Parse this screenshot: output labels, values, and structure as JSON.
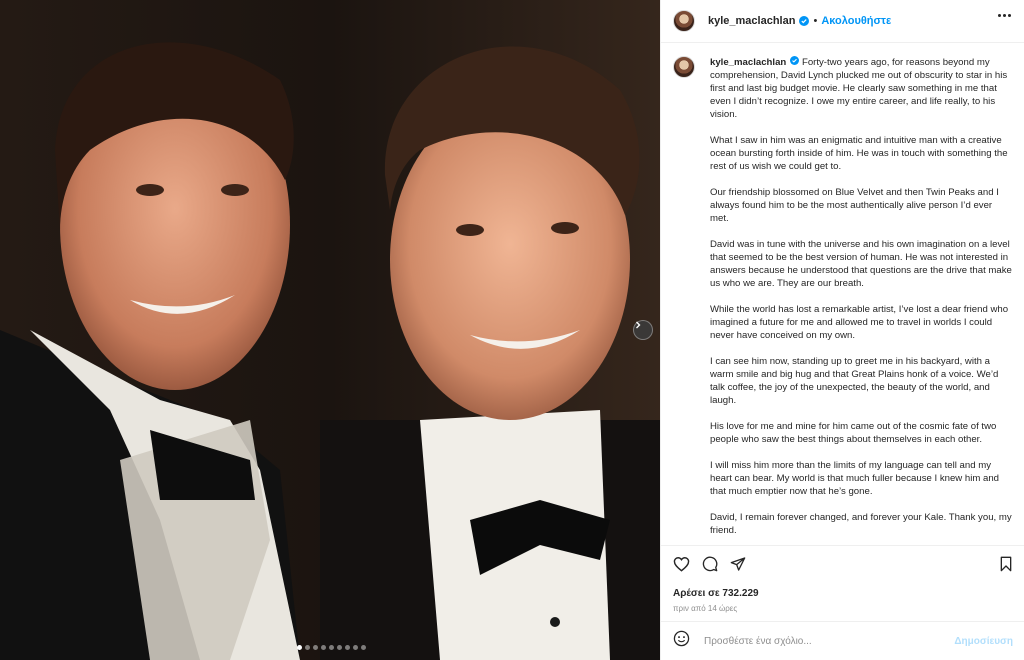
{
  "post": {
    "username": "kyle_maclachlan",
    "follow_label": "Ακολουθήστε",
    "separator": "•",
    "caption_author": "kyle_maclachlan",
    "caption_paragraphs": [
      "Forty-two years ago, for reasons beyond my comprehension, David Lynch plucked me out of obscurity to star in his first and last big budget movie. He clearly saw something in me that even I didn’t recognize. I owe my entire career, and life really, to his vision.",
      "What I saw in him was an enigmatic and intuitive man with a creative ocean bursting forth inside of him. He was in touch with something the rest of us wish we could get to.",
      "Our friendship blossomed on Blue Velvet and then Twin Peaks and I always found him to be the most authentically alive person I’d ever met.",
      "David was in tune with the universe and his own imagination on a level that seemed to be the best version of human. He was not interested in answers because he understood that questions are the drive that make us who we are. They are our breath.",
      "While the world has lost a remarkable artist, I’ve lost a dear friend who imagined a future for me and allowed me to travel in worlds I could never have conceived on my own.",
      "I can see him now, standing up to greet me in his backyard, with a warm smile and big hug and that Great Plains honk of a voice. We’d talk coffee, the joy of the unexpected, the beauty of the world, and laugh.",
      "His love for me and mine for him came out of the cosmic fate of two people who saw the best things about themselves in each other.",
      "I will miss him more than the limits of my language can tell and my heart can bear. My world is that much fuller because I knew him and that much emptier now that he’s gone.",
      "David, I remain forever changed, and forever your Kale. Thank you, my friend."
    ],
    "likes_label": "Αρέσει σε 732.229",
    "time_label": "πριν από 14 ώρες"
  },
  "comment": {
    "placeholder": "Προσθέστε ένα σχόλιο...",
    "post_label": "Δημοσίευση"
  },
  "carousel": {
    "total_slides": 9,
    "active_index": 0
  },
  "colors": {
    "accent": "#0095f6",
    "verified": "#0095f6",
    "post_disabled": "#b2dffc"
  },
  "icons": [
    "verified-badge-icon",
    "more-options-icon",
    "heart-icon",
    "comment-icon",
    "share-icon",
    "bookmark-icon",
    "emoji-icon",
    "chevron-right-icon"
  ]
}
